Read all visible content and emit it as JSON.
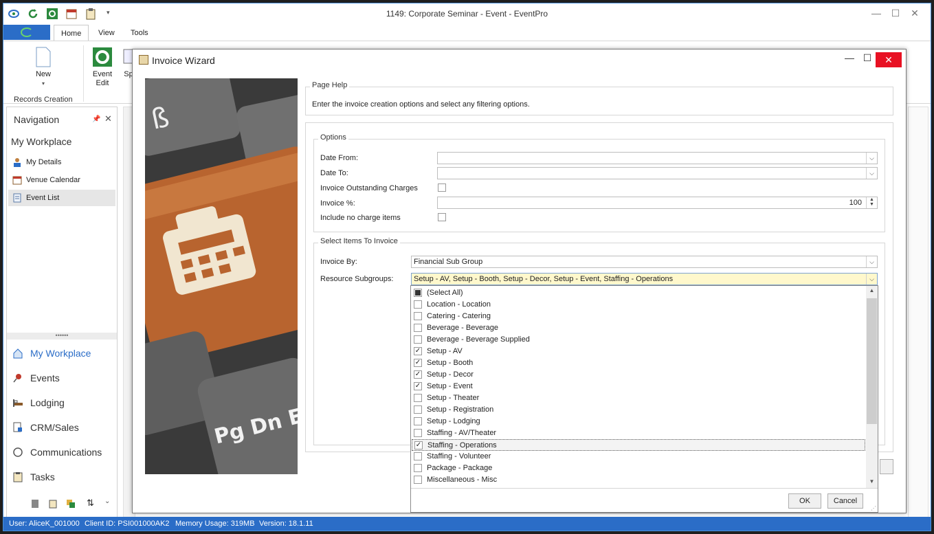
{
  "window": {
    "title": "1149: Corporate Seminar - Event - EventPro",
    "minimize": "—",
    "maximize": "☐",
    "close": "✕"
  },
  "ribbon": {
    "tabs": [
      "Home",
      "View",
      "Tools"
    ],
    "new_label": "New",
    "event_edit_label": "Event\nEdit",
    "records_creation_label": "Records Creation",
    "sp_label": "Sp"
  },
  "nav": {
    "header": "Navigation",
    "workplace_title": "My Workplace",
    "items": [
      "My Details",
      "Venue Calendar",
      "Event List"
    ],
    "sections": [
      "My Workplace",
      "Events",
      "Lodging",
      "CRM/Sales",
      "Communications",
      "Tasks"
    ]
  },
  "status": {
    "user": "User: AliceK_001000",
    "client": "Client ID: PSI001000AK2",
    "memory": "Memory Usage: 319MB",
    "version": "Version: 18.1.11"
  },
  "dialog": {
    "title": "Invoice Wizard",
    "page_help_label": "Page Help",
    "page_help_text": "Enter the invoice creation options and select any filtering options.",
    "options_label": "Options",
    "date_from_label": "Date From:",
    "date_from_value": "",
    "date_to_label": "Date To:",
    "date_to_value": "",
    "outstanding_label": "Invoice Outstanding Charges",
    "percent_label": "Invoice %:",
    "percent_value": "100",
    "no_charge_label": "Include no charge items",
    "select_items_label": "Select Items To Invoice",
    "invoice_by_label": "Invoice By:",
    "invoice_by_value": "Financial Sub Group",
    "resource_label": "Resource Subgroups:",
    "resource_value": "Setup - AV, Setup - Booth, Setup - Decor, Setup - Event, Staffing - Operations"
  },
  "dropdown": {
    "items": [
      {
        "label": "(Select All)",
        "state": "partial"
      },
      {
        "label": "Location - Location",
        "state": "off"
      },
      {
        "label": "Catering - Catering",
        "state": "off"
      },
      {
        "label": "Beverage - Beverage",
        "state": "off"
      },
      {
        "label": "Beverage - Beverage Supplied",
        "state": "off"
      },
      {
        "label": "Setup - AV",
        "state": "on"
      },
      {
        "label": "Setup - Booth",
        "state": "on"
      },
      {
        "label": "Setup - Decor",
        "state": "on"
      },
      {
        "label": "Setup - Event",
        "state": "on"
      },
      {
        "label": "Setup - Theater",
        "state": "off"
      },
      {
        "label": "Setup - Registration",
        "state": "off"
      },
      {
        "label": "Setup - Lodging",
        "state": "off"
      },
      {
        "label": "Staffing - AV/Theater",
        "state": "off"
      },
      {
        "label": "Staffing - Operations",
        "state": "on"
      },
      {
        "label": "Staffing - Volunteer",
        "state": "off"
      },
      {
        "label": "Package - Package",
        "state": "off"
      },
      {
        "label": "Miscellaneous - Misc",
        "state": "off"
      }
    ],
    "ok_label": "OK",
    "cancel_label": "Cancel"
  },
  "keyboard_art": {
    "key1": "ß",
    "key2": "Pg Dn E"
  },
  "colors": {
    "accent": "#2b6dc7",
    "close_red": "#e81123",
    "highlight": "#fff8cc"
  }
}
